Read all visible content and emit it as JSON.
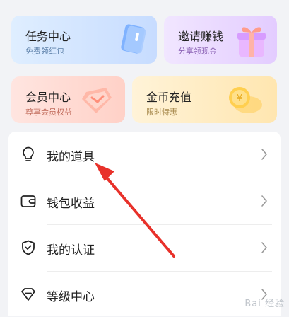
{
  "cards": [
    {
      "title": "任务中心",
      "subtitle": "免费领红包"
    },
    {
      "title": "邀请赚钱",
      "subtitle": "分享领现金"
    },
    {
      "title": "会员中心",
      "subtitle": "尊享会员权益"
    },
    {
      "title": "金币充值",
      "subtitle": "限时特惠"
    }
  ],
  "menu": [
    {
      "label": "我的道具",
      "icon": "bulb-icon"
    },
    {
      "label": "钱包收益",
      "icon": "wallet-icon"
    },
    {
      "label": "我的认证",
      "icon": "shield-check-icon"
    },
    {
      "label": "等级中心",
      "icon": "level-icon"
    }
  ],
  "watermark": "Bai 经验",
  "colors": {
    "accent_arrow": "#e8312a"
  }
}
